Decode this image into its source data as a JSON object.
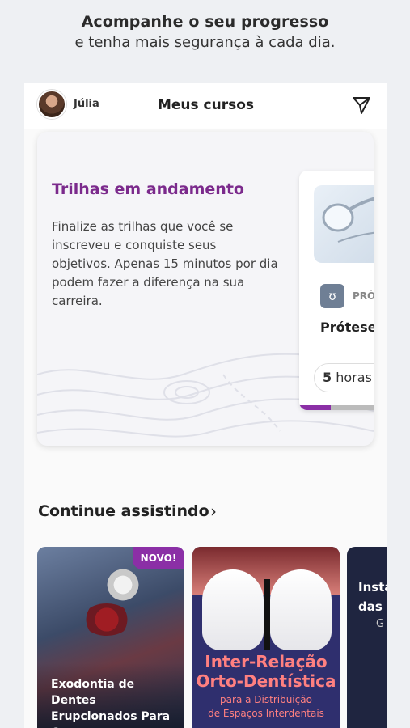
{
  "promo": {
    "headline": "Acompanhe o seu progresso",
    "subline": "e tenha mais segurança à cada dia."
  },
  "header": {
    "username": "Júlia",
    "title": "Meus cursos"
  },
  "trails": {
    "title": "Trilhas em andamento",
    "description": "Finalize as trilhas que você se inscreveu e conquiste seus objetivos. Apenas 15 minutos por dia podem fazer a diferença na sua carreira.",
    "course": {
      "category": "PRÓ",
      "name": "Prótese",
      "hours_number": "5",
      "hours_unit": " horas",
      "progress": 0.35
    }
  },
  "continue_watching": {
    "title": "Continue assistindo",
    "items": [
      {
        "badge": "NOVO!",
        "title": "Exodontia de Dentes Erupcionados Para Concursos"
      },
      {
        "title_line1": "Inter-Relação",
        "title_line2": "Orto-Dentística",
        "subtitle_line1": "para a Distribuição",
        "subtitle_line2": "de Espaços Interdentais"
      },
      {
        "title_line1": "Insta",
        "title_line2": "das F",
        "subtitle": "G"
      }
    ]
  },
  "colors": {
    "accent": "#7b2a8c",
    "badge": "#8b2fa6"
  }
}
